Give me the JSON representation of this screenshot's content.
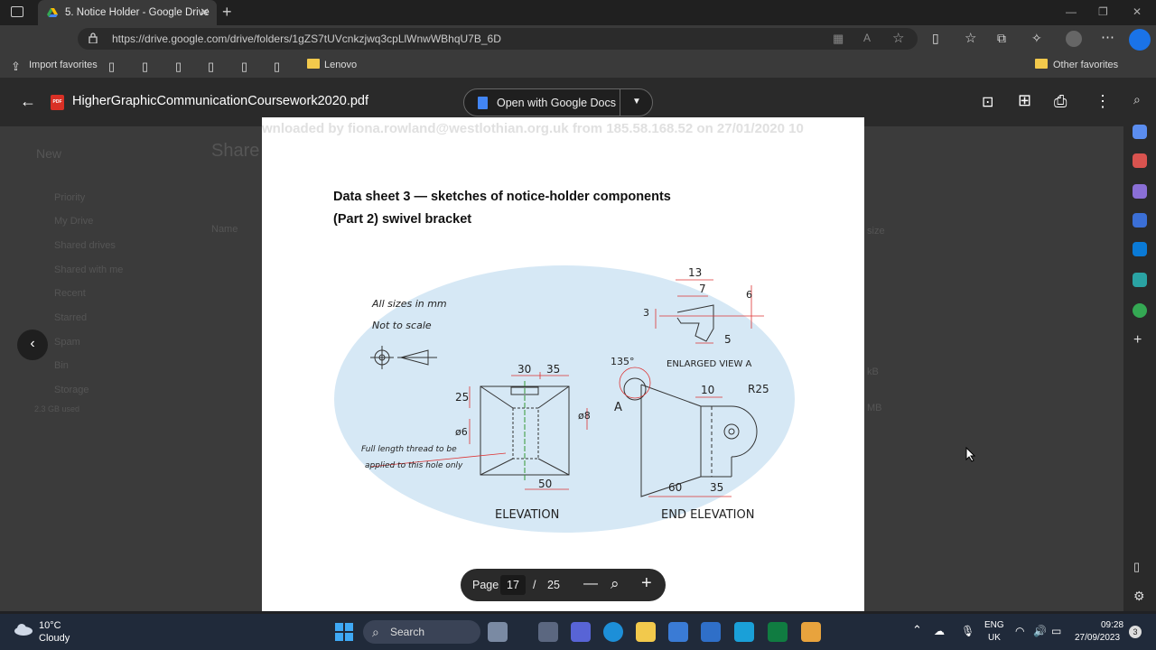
{
  "browser": {
    "tab_title": "5. Notice Holder - Google Drive",
    "url": "https://drive.google.com/drive/folders/1gZS7tUVcnkzjwq3cpLlWnwWBhqU7B_6D",
    "bookmarks": [
      "Import favorites",
      "Lenovo"
    ],
    "other_favorites": "Other favorites"
  },
  "viewer": {
    "file_name": "HigherGraphicCommunicationCoursework2020.pdf",
    "open_with": "Open with Google Docs",
    "page_label": "Page",
    "page_current": "17",
    "page_sep": "/",
    "page_total": "25"
  },
  "document": {
    "watermark": "wnloaded by fiona.rowland@westlothian.org.uk from 185.58.168.52 on 27/01/2020 10",
    "heading1": "Data sheet 3 — sketches of notice-holder components",
    "heading2": "(Part 2) swivel bracket",
    "note1": "All sizes in mm",
    "note2": "Not to scale",
    "thread_note1": "Full length thread to be",
    "thread_note2": "applied to this hole only",
    "elevation": "ELEVATION",
    "end_elevation": "END ELEVATION",
    "enlarged": "ENLARGED VIEW A",
    "marker_a": "A",
    "dims": {
      "d13": "13",
      "d7": "7",
      "d6": "6",
      "d3": "3",
      "d5": "5",
      "d30": "30",
      "d35": "35",
      "d25": "25",
      "d8": "ø8",
      "d6b": "ø6",
      "d50": "50",
      "d135": "135°",
      "d10": "10",
      "r25": "R25",
      "d60": "60",
      "d35b": "35"
    }
  },
  "drive_bg": {
    "new": "New",
    "priority": "Priority",
    "my_drive": "My Drive",
    "shared_drives": "Shared drives",
    "shared_with_me": "Shared with me",
    "recent": "Recent",
    "starred": "Starred",
    "spam": "Spam",
    "bin": "Bin",
    "storage": "Storage",
    "storage_used": "2.3 GB used",
    "shared_title": "Share",
    "name_col": "Name",
    "size_col": "size",
    "size1": "kB",
    "size2": "MB"
  },
  "taskbar": {
    "temp": "10°C",
    "weather": "Cloudy",
    "search": "Search",
    "lang1": "ENG",
    "lang2": "UK",
    "time": "09:28",
    "date": "27/09/2023",
    "badge": "3"
  },
  "colors": {
    "accent": "#4285f4",
    "pdf_red": "#d93025",
    "sketch_bg": "#d6e8f5"
  }
}
